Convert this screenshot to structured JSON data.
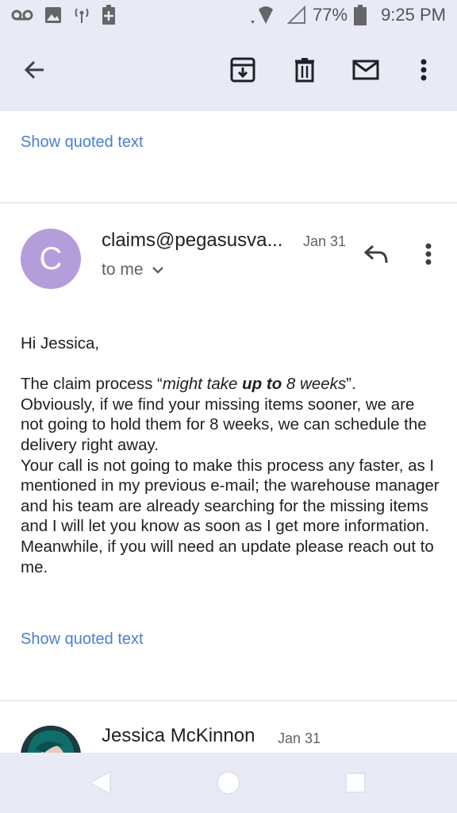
{
  "status": {
    "battery": "77%",
    "time": "9:25 PM"
  },
  "header": {
    "icons": [
      "back-arrow-icon",
      "archive-icon",
      "delete-icon",
      "mark-unread-icon",
      "more-vert-icon"
    ]
  },
  "thread": {
    "show_quoted_top": "Show quoted text",
    "message": {
      "avatar_letter": "C",
      "sender": "claims@pegasusva...",
      "date": "Jan 31",
      "to": "to me",
      "greeting": "Hi Jessica,",
      "p1_a": "The claim process “",
      "p1_b": "might take ",
      "p1_c": "up to",
      "p1_d": " 8 weeks",
      "p1_e": "”.",
      "p2": "Obviously, if we find your missing items sooner, we are not going to hold them for 8 weeks, we can schedule the delivery right away.",
      "p3": "Your call is not going to make this process any faster, as I mentioned in my previous e-mail; the warehouse manager and his team are already searching for the missing items and I will let you know as soon as I get more information.",
      "p4": "Meanwhile, if you will need an update please reach out to me.",
      "show_quoted": "Show quoted text"
    },
    "next_message": {
      "sender": "Jessica McKinnon",
      "date": "Jan 31"
    }
  },
  "colors": {
    "bar_bg": "#e8eaf6",
    "link": "#4a7fd0",
    "avatar": "#b39ddb"
  }
}
